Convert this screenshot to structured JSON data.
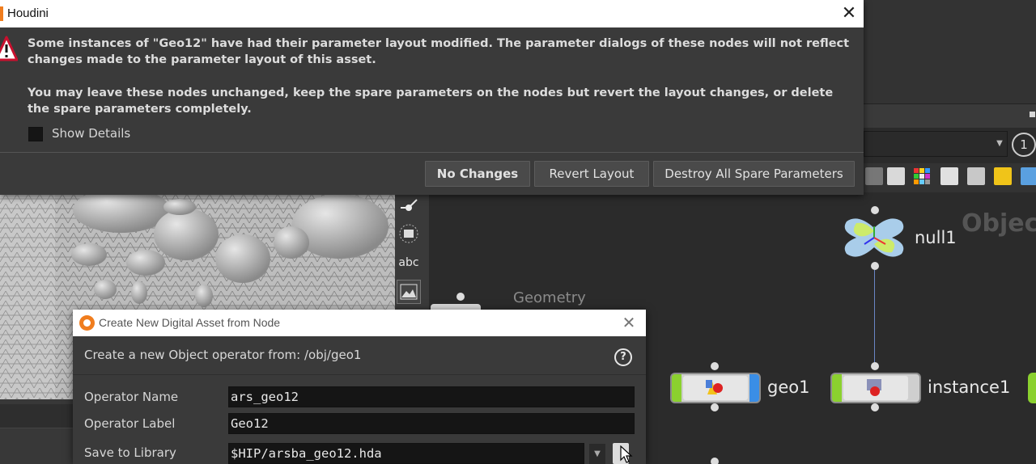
{
  "warning_dialog": {
    "title": "Houdini",
    "message_1": "Some instances of \"Geo12\" have had their parameter layout modified. The parameter dialogs of these nodes will not reflect changes made to the parameter layout of this asset.",
    "message_2": "You may leave these nodes unchanged, keep the spare parameters on the nodes but revert the layout changes, or delete the spare parameters completely.",
    "show_details_label": "Show Details",
    "buttons": {
      "no_changes": "No Changes",
      "revert_layout": "Revert Layout",
      "destroy": "Destroy All Spare Parameters"
    },
    "close_glyph": "✕"
  },
  "hda_dialog": {
    "title": "Create New Digital Asset from Node",
    "description": "Create a new Object operator from: /obj/geo1",
    "help_glyph": "?",
    "fields": {
      "operator_name_label": "Operator Name",
      "operator_name_value": "ars_geo12",
      "operator_label_label": "Operator Label",
      "operator_label_value": "Geo12",
      "save_to_library_label": "Save to Library",
      "save_to_library_value": "$HIP/arsba_geo12.hda"
    },
    "close_glyph": "✕"
  },
  "network": {
    "heading": "Objec",
    "geometry_label": "Geometry",
    "nodes": {
      "null1": "null1",
      "geo1": "geo1",
      "instance1": "instance1"
    },
    "circle_indicator": "1"
  },
  "viewport": {
    "abc_label": "abc"
  },
  "colors": {
    "houdini_orange": "#f07d1e",
    "dialog_bg": "#3a3a3a",
    "node_green": "#8bd12f",
    "node_blue": "#3a8ee6",
    "null_blue": "#a9cdea"
  }
}
